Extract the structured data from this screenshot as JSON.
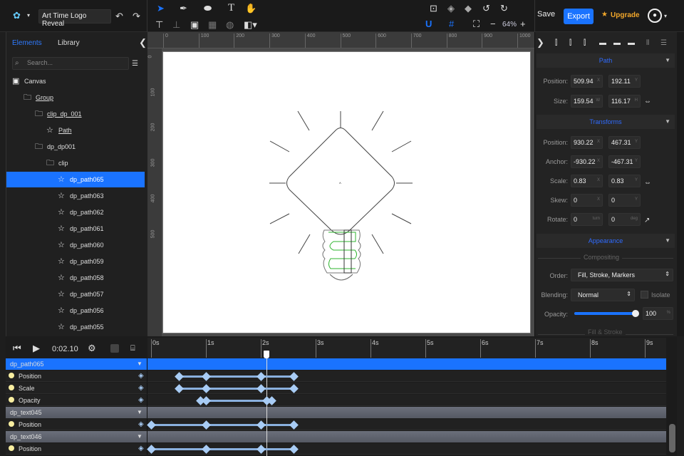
{
  "header": {
    "project_title": "Art Time Logo Reveal",
    "save": "Save",
    "export": "Export",
    "upgrade": "Upgrade",
    "zoom": "64%",
    "zoom_minus": "−",
    "zoom_plus": "+"
  },
  "left_panel": {
    "tabs": [
      "Elements",
      "Library"
    ],
    "search_placeholder": "Search...",
    "tree": [
      {
        "label": "Canvas",
        "icon": "canvas-icon",
        "indent": 0,
        "underline": false
      },
      {
        "label": "Group",
        "icon": "folder-icon",
        "indent": 1,
        "underline": true
      },
      {
        "label": "clip_dp_001",
        "icon": "folder-icon",
        "indent": 2,
        "underline": true
      },
      {
        "label": "Path",
        "icon": "path-icon",
        "indent": 3,
        "underline": true
      },
      {
        "label": "dp_dp001",
        "icon": "folder-icon",
        "indent": 2,
        "underline": false
      },
      {
        "label": "clip",
        "icon": "folder-icon",
        "indent": 3,
        "underline": false
      },
      {
        "label": "dp_path065",
        "icon": "path-icon",
        "indent": 4,
        "underline": false,
        "selected": true
      },
      {
        "label": "dp_path063",
        "icon": "path-icon",
        "indent": 4
      },
      {
        "label": "dp_path062",
        "icon": "path-icon",
        "indent": 4
      },
      {
        "label": "dp_path061",
        "icon": "path-icon",
        "indent": 4
      },
      {
        "label": "dp_path060",
        "icon": "path-icon",
        "indent": 4
      },
      {
        "label": "dp_path059",
        "icon": "path-icon",
        "indent": 4
      },
      {
        "label": "dp_path058",
        "icon": "path-icon",
        "indent": 4
      },
      {
        "label": "dp_path057",
        "icon": "path-icon",
        "indent": 4
      },
      {
        "label": "dp_path056",
        "icon": "path-icon",
        "indent": 4
      },
      {
        "label": "dp_path055",
        "icon": "path-icon",
        "indent": 4
      }
    ]
  },
  "rulers": {
    "top": [
      "0",
      "100",
      "200",
      "300",
      "400",
      "500",
      "600",
      "700",
      "800",
      "900",
      "1000"
    ],
    "left": [
      "0",
      "100",
      "200",
      "300",
      "400",
      "500"
    ]
  },
  "right_panel": {
    "path": {
      "title": "Path",
      "position_label": "Position:",
      "position_x": "509.94",
      "position_y": "192.11",
      "size_label": "Size:",
      "size_w": "159.54",
      "size_h": "116.17"
    },
    "transforms": {
      "title": "Transforms",
      "position_label": "Position:",
      "position_x": "930.22",
      "position_y": "467.31",
      "anchor_label": "Anchor:",
      "anchor_x": "-930.22",
      "anchor_y": "-467.31",
      "scale_label": "Scale:",
      "scale_x": "0.83",
      "scale_y": "0.83",
      "skew_label": "Skew:",
      "skew_x": "0",
      "skew_y": "0",
      "rotate_label": "Rotate:",
      "rotate_turn": "0",
      "rotate_deg": "0"
    },
    "units": {
      "x": "X",
      "y": "Y",
      "w": "W",
      "h": "H",
      "turn": "turn",
      "deg": "deg",
      "pct": "%"
    },
    "appearance": {
      "title": "Appearance",
      "compositing": "Compositing",
      "order_label": "Order:",
      "order_value": "Fill, Stroke, Markers",
      "blending_label": "Blending:",
      "blending_value": "Normal",
      "isolate_label": "Isolate",
      "opacity_label": "Opacity:",
      "opacity_value": "100",
      "opacity_fraction": 1.0,
      "fill_stroke": "Fill & Stroke"
    }
  },
  "timeline": {
    "time": "0:02.10",
    "current_time_s": 2.1,
    "ticks": [
      "0s",
      "1s",
      "2s",
      "3s",
      "4s",
      "5s",
      "6s",
      "7s",
      "8s",
      "9s"
    ],
    "rows": [
      {
        "type": "group-selected",
        "label": "dp_path065"
      },
      {
        "type": "prop",
        "label": "Position",
        "keys": [
          0.5,
          1.0,
          2.0,
          2.6
        ]
      },
      {
        "type": "prop",
        "label": "Scale",
        "keys": [
          0.5,
          1.0,
          2.0,
          2.6
        ]
      },
      {
        "type": "prop",
        "label": "Opacity",
        "keys": [
          0.9,
          1.0,
          2.1,
          2.2
        ]
      },
      {
        "type": "group",
        "label": "dp_text045"
      },
      {
        "type": "prop",
        "label": "Position",
        "keys": [
          0,
          1.0,
          2.0,
          2.6
        ]
      },
      {
        "type": "group",
        "label": "dp_text046"
      },
      {
        "type": "prop",
        "label": "Position",
        "keys": [
          0,
          1.0,
          2.0,
          2.6
        ]
      }
    ]
  },
  "colors": {
    "accent": "#1a73ff",
    "upgrade": "#f2a72b",
    "keyframe": "#a8ccf5",
    "filament": "#2fb52f"
  }
}
